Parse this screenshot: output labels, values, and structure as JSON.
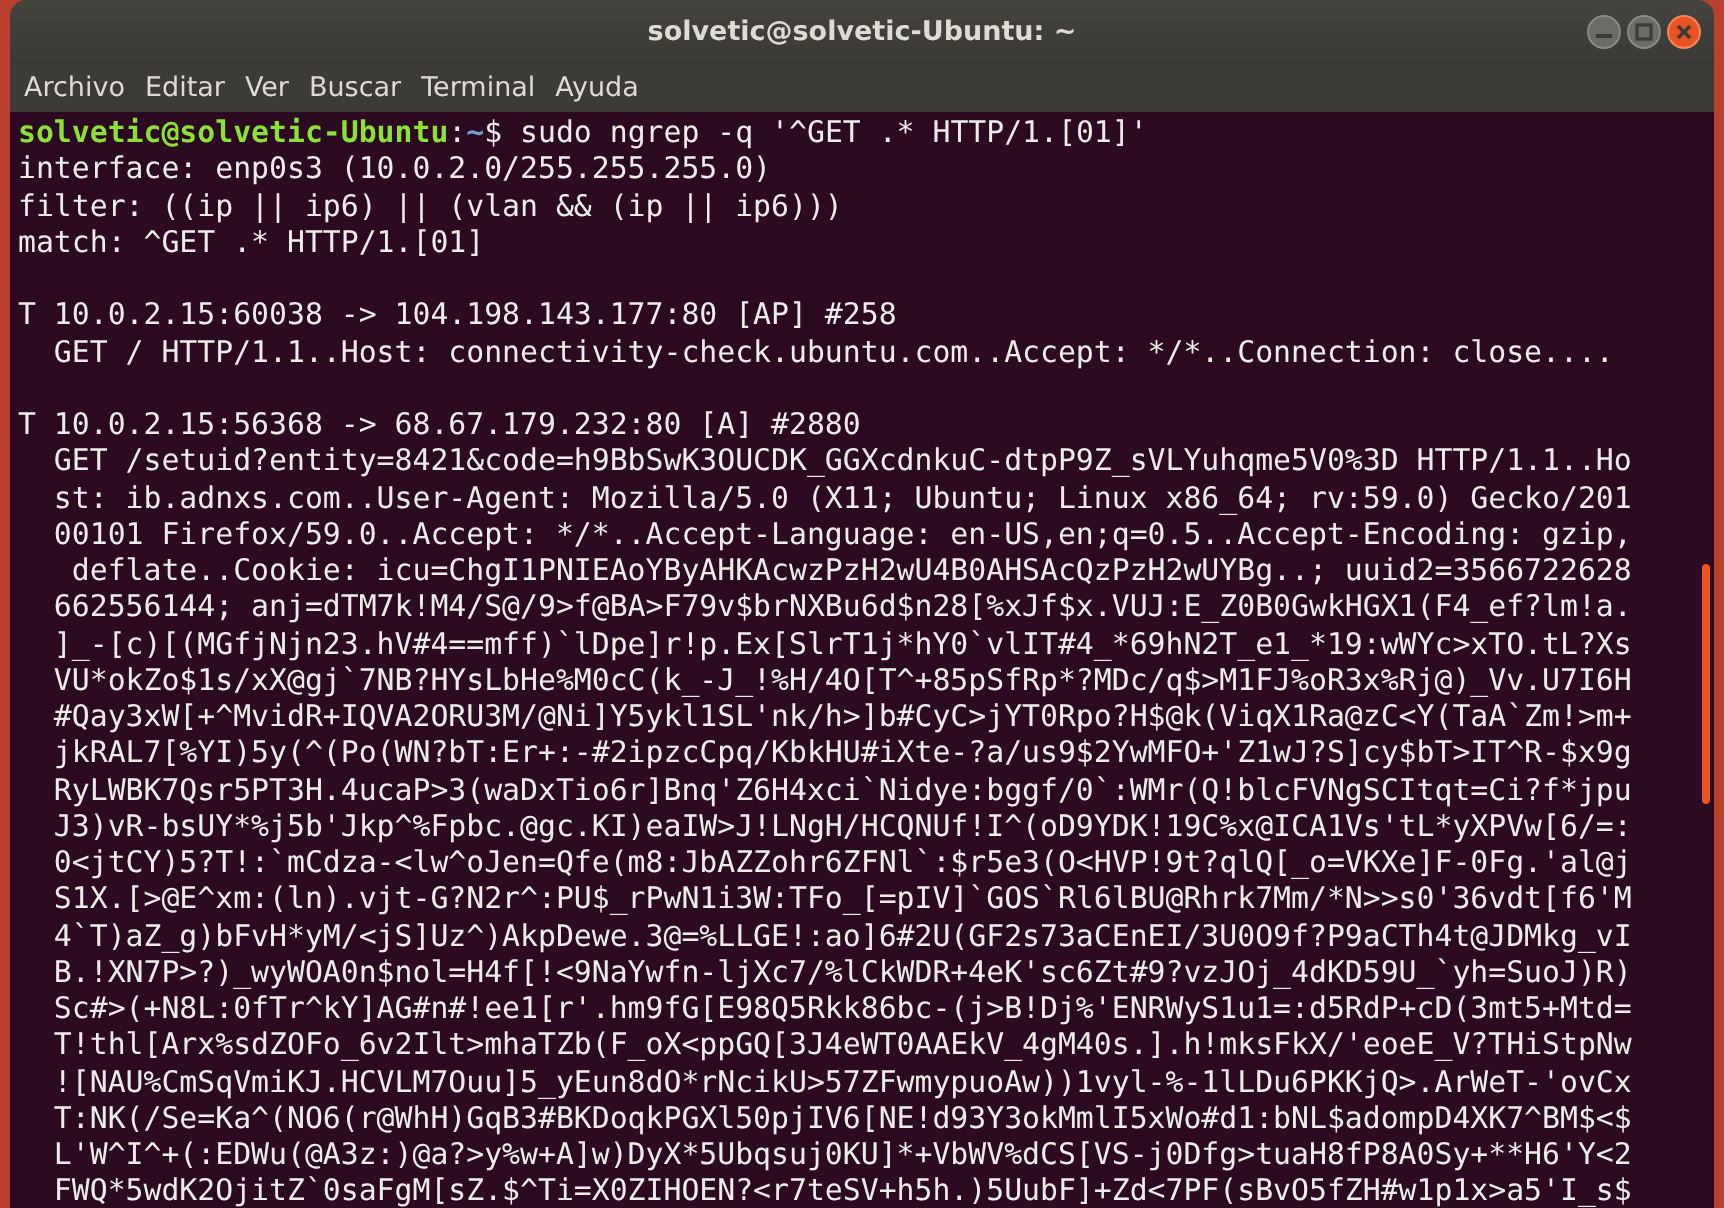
{
  "window": {
    "title": "solvetic@solvetic-Ubuntu: ~"
  },
  "menu": [
    "Archivo",
    "Editar",
    "Ver",
    "Buscar",
    "Terminal",
    "Ayuda"
  ],
  "terminal": {
    "lines": [
      {
        "kind": "prompt",
        "user": "solvetic@solvetic-Ubuntu",
        "separator": ":",
        "path": "~",
        "command": "$ sudo ngrep -q '^GET .* HTTP/1.[01]'"
      },
      {
        "kind": "output",
        "text": "interface: enp0s3 (10.0.2.0/255.255.255.0)"
      },
      {
        "kind": "output",
        "text": "filter: ((ip || ip6) || (vlan && (ip || ip6)))"
      },
      {
        "kind": "output",
        "text": "match: ^GET .* HTTP/1.[01]"
      },
      {
        "kind": "blank"
      },
      {
        "kind": "output",
        "text": "T 10.0.2.15:60038 -> 104.198.143.177:80 [AP] #258"
      },
      {
        "kind": "output",
        "text": "  GET / HTTP/1.1..Host: connectivity-check.ubuntu.com..Accept: */*..Connection: close...."
      },
      {
        "kind": "blank"
      },
      {
        "kind": "output",
        "text": "T 10.0.2.15:56368 -> 68.67.179.232:80 [A] #2880"
      },
      {
        "kind": "output",
        "text": "  GET /setuid?entity=8421&code=h9BbSwK3OUCDK_GGXcdnkuC-dtpP9Z_sVLYuhqme5V0%3D HTTP/1.1..Ho"
      },
      {
        "kind": "output",
        "text": "  st: ib.adnxs.com..User-Agent: Mozilla/5.0 (X11; Ubuntu; Linux x86_64; rv:59.0) Gecko/201"
      },
      {
        "kind": "output",
        "text": "  00101 Firefox/59.0..Accept: */*..Accept-Language: en-US,en;q=0.5..Accept-Encoding: gzip,"
      },
      {
        "kind": "output",
        "text": "   deflate..Cookie: icu=ChgI1PNIEAoYByAHKAcwzPzH2wU4B0AHSAcQzPzH2wUYBg..; uuid2=3566722628"
      },
      {
        "kind": "output",
        "text": "  662556144; anj=dTM7k!M4/S@/9>f@BA>F79v$brNXBu6d$n28[%xJf$x.VUJ:E_Z0B0GwkHGX1(F4_ef?lm!a."
      },
      {
        "kind": "output",
        "text": "  ]_-[c)[(MGfjNjn23.hV#4==mff)`lDpe]r!p.Ex[SlrT1j*hY0`vlIT#4_*69hN2T_e1_*19:wWYc>xTO.tL?Xs"
      },
      {
        "kind": "output",
        "text": "  VU*okZo$1s/xX@gj`7NB?HYsLbHe%M0cC(k_-J_!%H/4O[T^+85pSfRp*?MDc/q$>M1FJ%oR3x%Rj@)_Vv.U7I6H"
      },
      {
        "kind": "output",
        "text": "  #Qay3xW[+^MvidR+IQVA2ORU3M/@Ni]Y5ykl1SL'nk/h>]b#CyC>jYT0Rpo?H$@k(ViqX1Ra@zC<Y(TaA`Zm!>m+"
      },
      {
        "kind": "output",
        "text": "  jkRAL7[%YI)5y(^(Po(WN?bT:Er+:-#2ipzcCpq/KbkHU#iXte-?a/us9$2YwMFO+'Z1wJ?S]cy$bT>IT^R-$x9g"
      },
      {
        "kind": "output",
        "text": "  RyLWBK7Qsr5PT3H.4ucaP>3(waDxTio6r]Bnq'Z6H4xci`Nidye:bggf/0`:WMr(Q!blcFVNgSCItqt=Ci?f*jpu"
      },
      {
        "kind": "output",
        "text": "  J3)vR-bsUY*%j5b'Jkp^%Fpbc.@gc.KI)eaIW>J!LNgH/HCQNUf!I^(oD9YDK!19C%x@ICA1Vs'tL*yXPVw[6/=:"
      },
      {
        "kind": "output",
        "text": "  0<jtCY)5?T!:`mCdza-<lw^oJen=Qfe(m8:JbAZZohr6ZFNl`:$r5e3(O<HVP!9t?qlQ[_o=VKXe]F-0Fg.'al@j"
      },
      {
        "kind": "output",
        "text": "  S1X.[>@E^xm:(ln).vjt-G?N2r^:PU$_rPwN1i3W:TFo_[=pIV]`GOS`Rl6lBU@Rhrk7Mm/*N>>s0'36vdt[f6'M"
      },
      {
        "kind": "output",
        "text": "  4`T)aZ_g)bFvH*yM/<jS]Uz^)AkpDewe.3@=%LLGE!:ao]6#2U(GF2s73aCEnEI/3U0O9f?P9aCTh4t@JDMkg_vI"
      },
      {
        "kind": "output",
        "text": "  B.!XN7P>?)_wyWOA0n$nol=H4f[!<9NaYwfn-ljXc7/%lCkWDR+4eK'sc6Zt#9?vzJOj_4dKD59U_`yh=SuoJ)R)"
      },
      {
        "kind": "output",
        "text": "  Sc#>(+N8L:0fTr^kY]AG#n#!ee1[r'.hm9fG[E98Q5Rkk86bc-(j>B!Dj%'ENRWyS1u1=:d5RdP+cD(3mt5+Mtd="
      },
      {
        "kind": "output",
        "text": "  T!thl[Arx%sdZOFo_6v2Ilt>mhaTZb(F_oX<ppGQ[3J4eWT0AAEkV_4gM40s.].h!mksFkX/'eoeE_V?THiStpNw"
      },
      {
        "kind": "output",
        "text": "  ![NAU%CmSqVmiKJ.HCVLM7Ouu]5_yEun8dO*rNcikU>57ZFwmypuoAw))1vyl-%-1lLDu6PKKjQ>.ArWeT-'ovCx"
      },
      {
        "kind": "output",
        "text": "  T:NK(/Se=Ka^(NO6(r@WhH)GqB3#BKDoqkPGXl50pjIV6[NE!d93Y3okMmlI5xWo#d1:bNL$adompD4XK7^BM$<$"
      },
      {
        "kind": "output",
        "text": "  L'W^I^+(:EDWu(@A3z:)@a?>y%w+A]w)DyX*5Ubqsuj0KU]*+VbWV%dCS[VS-j0Dfg>tuaH8fP8A0Sy+**H6'Y<2"
      },
      {
        "kind": "output",
        "text": "  FWQ*5wdK2OjitZ`0saFgM[sZ.$^Ti=X0ZIHOEN?<r7teSV+h5h.)5UubF]+Zd<7PF(sBvO5fZH#w1p1x>a5'I_s$"
      }
    ]
  }
}
